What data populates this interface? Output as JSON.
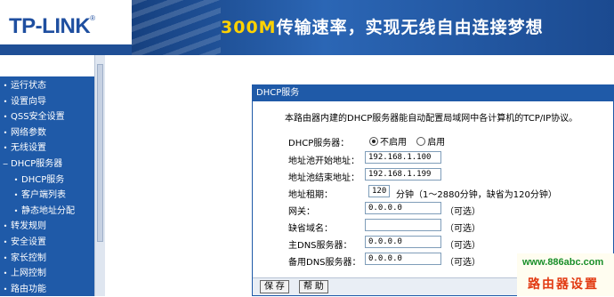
{
  "header": {
    "logo": "TP-LINK",
    "logo_reg": "®",
    "slogan_highlight": "300M",
    "slogan_rest": "传输速率，实现无线自由连接梦想"
  },
  "sidebar": {
    "items": [
      {
        "label": "运行状态",
        "sub": false
      },
      {
        "label": "设置向导",
        "sub": false
      },
      {
        "label": "QSS安全设置",
        "sub": false
      },
      {
        "label": "网络参数",
        "sub": false
      },
      {
        "label": "无线设置",
        "sub": false
      },
      {
        "label": "DHCP服务器",
        "sub": false
      },
      {
        "label": "DHCP服务",
        "sub": true
      },
      {
        "label": "客户端列表",
        "sub": true
      },
      {
        "label": "静态地址分配",
        "sub": true
      },
      {
        "label": "转发规则",
        "sub": false
      },
      {
        "label": "安全设置",
        "sub": false
      },
      {
        "label": "家长控制",
        "sub": false
      },
      {
        "label": "上网控制",
        "sub": false
      },
      {
        "label": "路由功能",
        "sub": false
      }
    ]
  },
  "panel": {
    "title": "DHCP服务",
    "description": "本路由器内建的DHCP服务器能自动配置局域网中各计算机的TCP/IP协议。",
    "dhcp_label": "DHCP服务器：",
    "dhcp_off": "不启用",
    "dhcp_on": "启用",
    "dhcp_selected": "不启用",
    "start_label": "地址池开始地址：",
    "start_value": "192.168.1.100",
    "end_label": "地址池结束地址：",
    "end_value": "192.168.1.199",
    "lease_label": "地址租期：",
    "lease_value": "120",
    "lease_unit": "分钟（1～2880分钟，缺省为120分钟）",
    "gateway_label": "网关：",
    "gateway_value": "0.0.0.0",
    "domain_label": "缺省域名：",
    "domain_value": "",
    "dns1_label": "主DNS服务器：",
    "dns1_value": "0.0.0.0",
    "dns2_label": "备用DNS服务器：",
    "dns2_value": "0.0.0.0",
    "optional": "（可选）",
    "save_label": "保 存",
    "help_label": "帮 助"
  },
  "watermark": {
    "url": "www.886abc.com",
    "name": "路由器设置"
  },
  "colors": {
    "nav_blue": "#1f5aa8",
    "banner_blue": "#1f4f96",
    "slogan_yellow": "#ffd200"
  }
}
